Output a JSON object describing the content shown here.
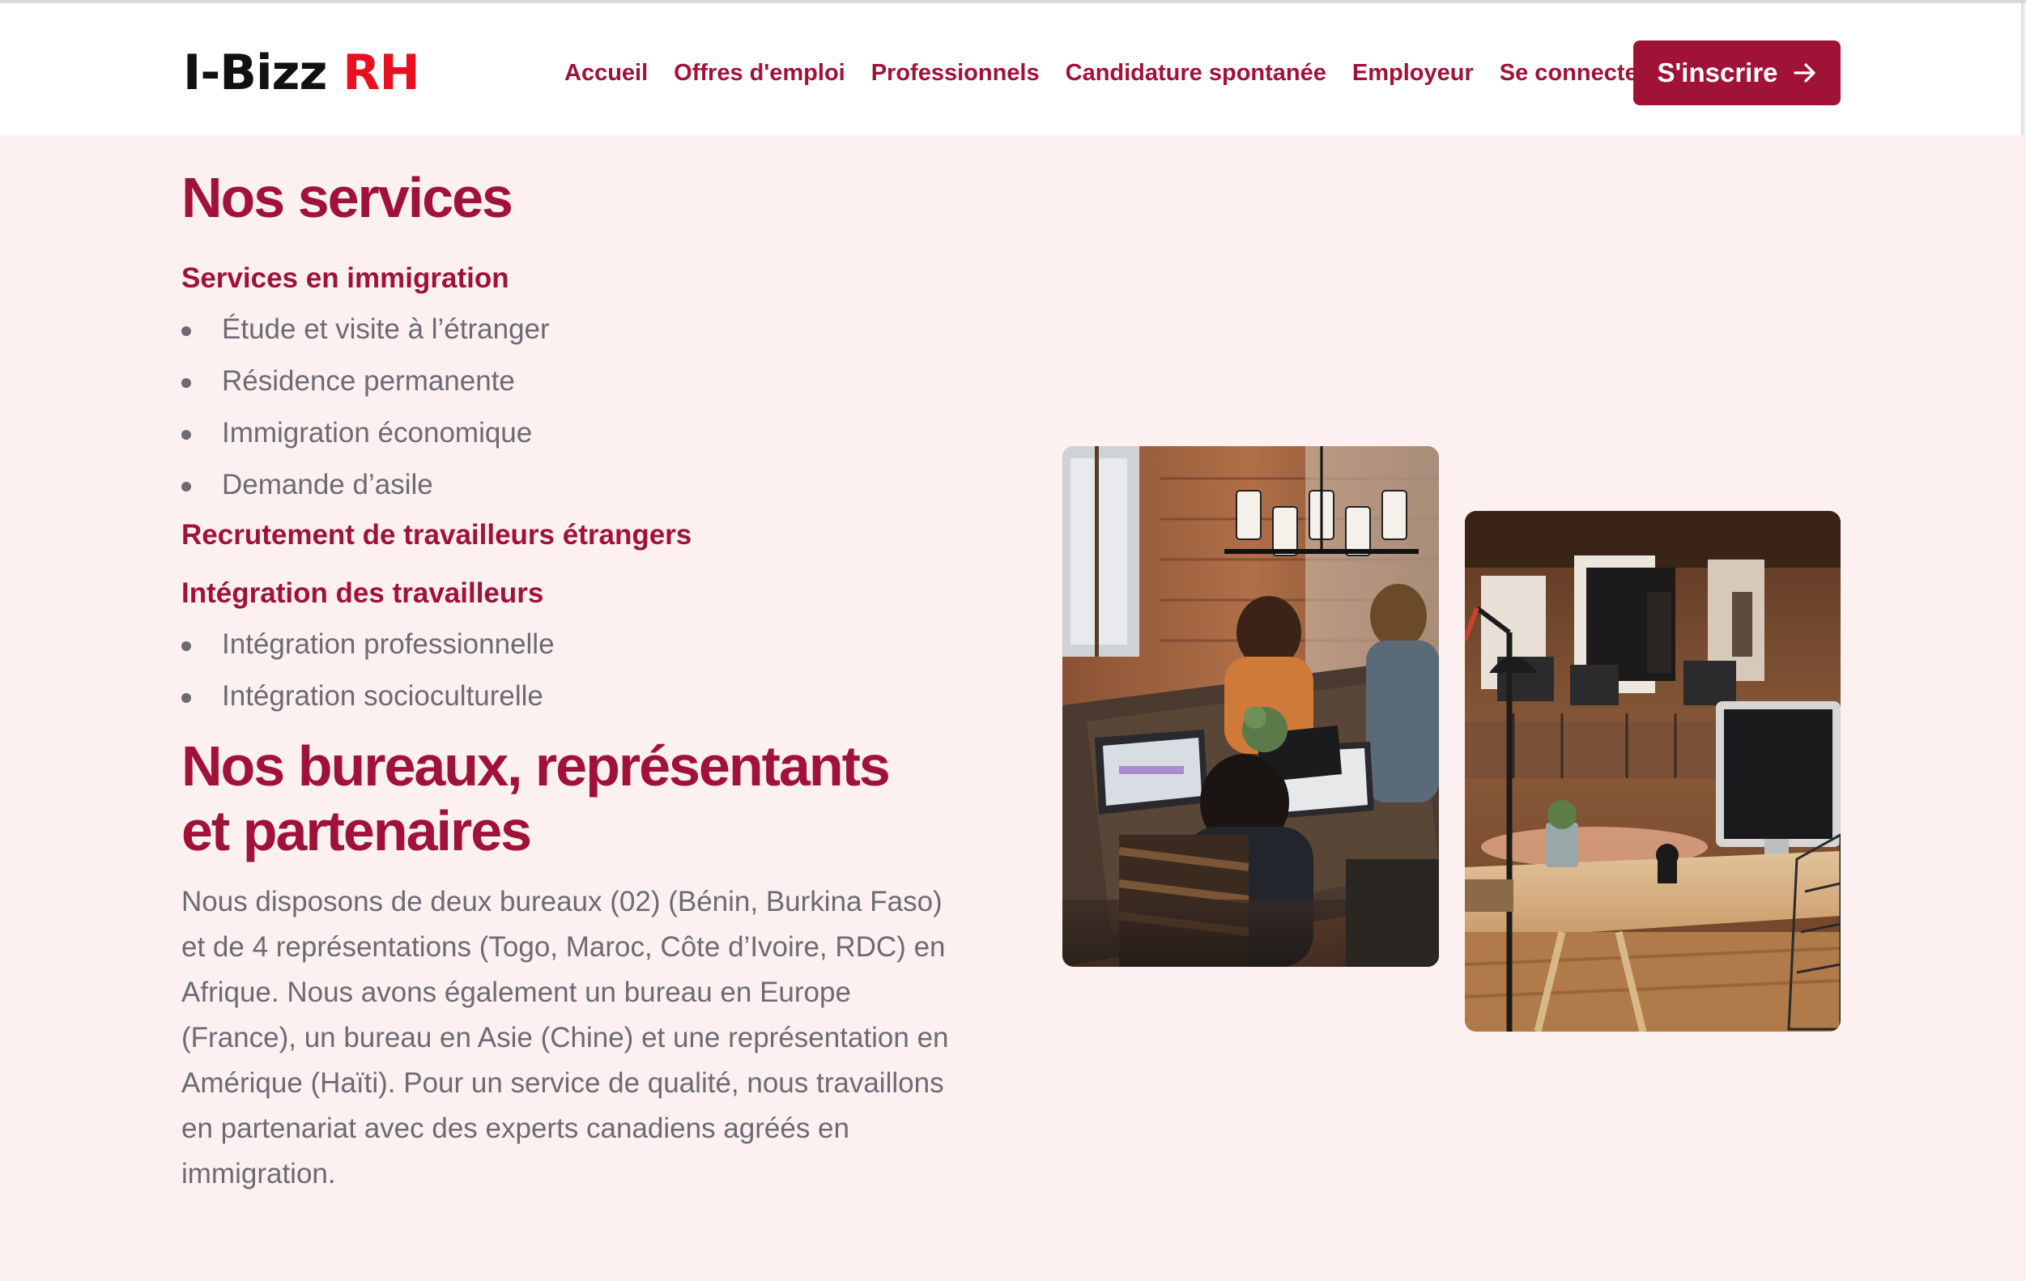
{
  "header": {
    "logo_main": "I-Bizz",
    "logo_accent": "RH",
    "nav": [
      "Accueil",
      "Offres d'emploi",
      "Professionnels",
      "Candidature spontanée",
      "Employeur",
      "Se connecter"
    ],
    "cta_label": "S'inscrire",
    "cta_icon": "arrow-right-icon"
  },
  "services": {
    "title": "Nos services",
    "immigration": {
      "heading": "Services en immigration",
      "items": [
        "Étude et visite à l’étranger",
        "Résidence permanente",
        "Immigration économique",
        "Demande d’asile"
      ]
    },
    "recruitment_heading": "Recrutement de travailleurs étrangers",
    "integration": {
      "heading": "Intégration des travailleurs",
      "items": [
        "Intégration professionnelle",
        "Intégration socioculturelle"
      ]
    }
  },
  "offices": {
    "title_line1": "Nos bureaux, représentants",
    "title_line2": "et partenaires",
    "paragraph": "Nous disposons de deux bureaux (02) (Bénin, Burkina Faso) et de 4 représentations (Togo, Maroc, Côte d’Ivoire, RDC) en Afrique. Nous avons également un bureau en Europe (France), un bureau en Asie (Chine) et une représentation en Amérique (Haïti). Pour un service de qualité, nous travaillons en partenariat avec des experts canadiens agréés en immigration."
  },
  "colors": {
    "brand": "#a01238",
    "logo_accent": "#e8101f",
    "page_background": "#fdf0f1",
    "body_text": "#6b6b73"
  }
}
